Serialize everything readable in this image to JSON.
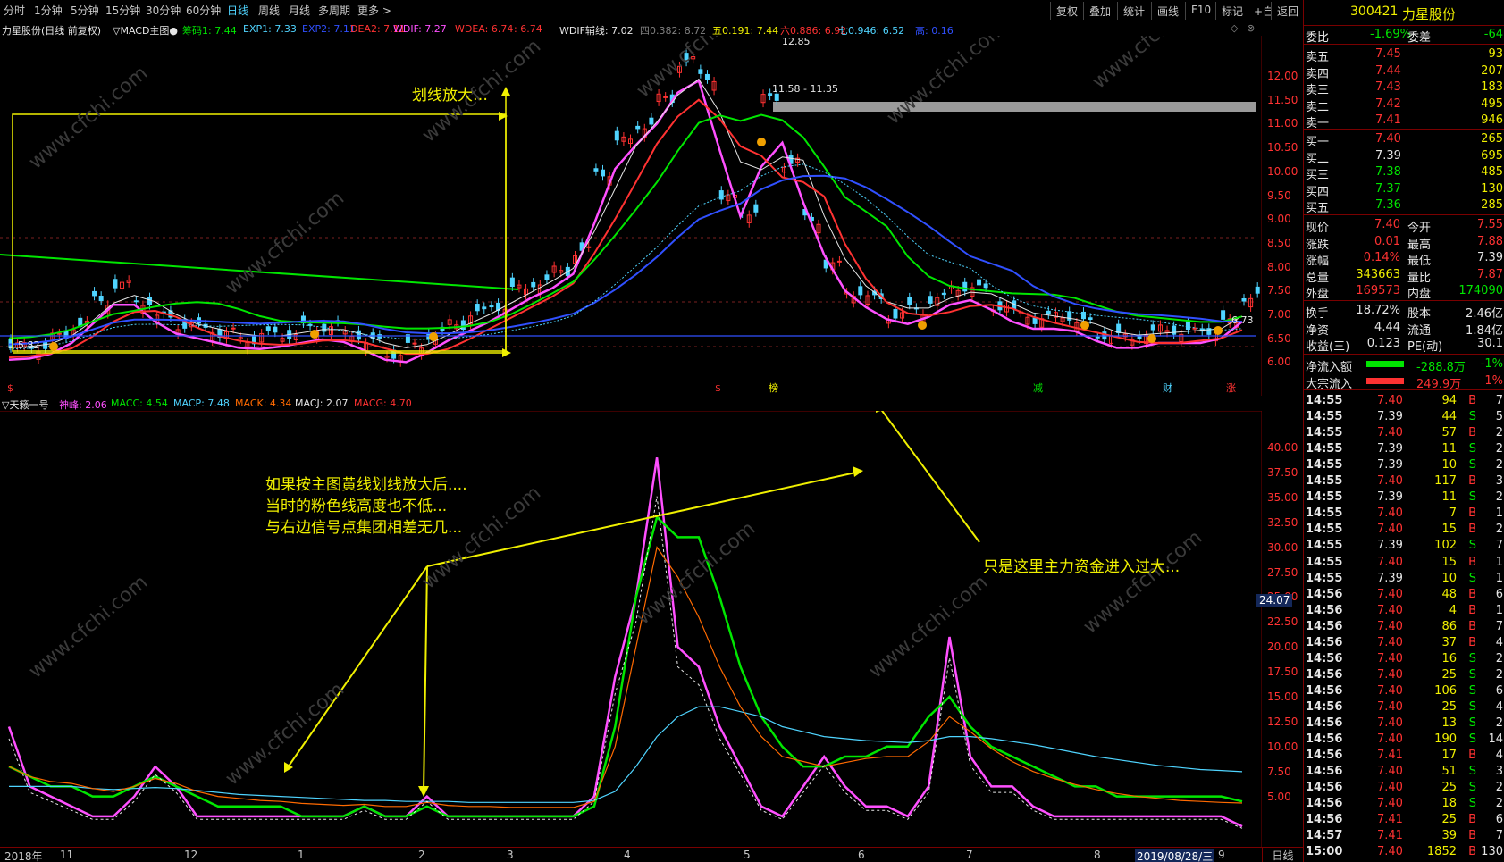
{
  "toolbar": {
    "periods": [
      "分时",
      "1分钟",
      "5分钟",
      "15分钟",
      "30分钟",
      "60分钟",
      "日线",
      "周线",
      "月线",
      "多周期",
      "更多"
    ],
    "active_period": "日线",
    "right_buttons": [
      "复权",
      "叠加",
      "统计",
      "画线",
      "F10",
      "标记",
      "+自选",
      "返回"
    ]
  },
  "main_header": {
    "stock": "力星股份(日线 前复权)",
    "indicator": "▽MACD主图●",
    "items": [
      {
        "label": "筹码1: 7.44",
        "color": "#00e600"
      },
      {
        "label": "EXP1: 7.33",
        "color": "#4fd4ff"
      },
      {
        "label": "EXP2: 7.11",
        "color": "#3050ff"
      },
      {
        "label": "DEA2: 7.11",
        "color": "#ff3232"
      },
      {
        "label": "WDIF: 7.27",
        "color": "#ff50ff"
      },
      {
        "label": "WDEA: 6.74",
        "color": "#ff3232"
      },
      {
        "label": ": 6.74",
        "color": "#ff3232"
      },
      {
        "label": "WDIF辅线: 7.02",
        "color": "#e6e6e6"
      },
      {
        "label": "四0.382: 8.72",
        "color": "#808080"
      },
      {
        "label": "五0.191: 7.44",
        "color": "#f0f000"
      },
      {
        "label": "六0.886: 6.92",
        "color": "#ff3232"
      },
      {
        "label": "七0.946: 6.52",
        "color": "#4fd4ff"
      },
      {
        "label": "高: 0.16",
        "color": "#3050ff"
      }
    ]
  },
  "sub_header": {
    "indicator": "▽天籁一号",
    "items": [
      {
        "label": "神峰: 2.06",
        "color": "#ff50ff"
      },
      {
        "label": "MACC: 4.54",
        "color": "#00e600"
      },
      {
        "label": "MACP: 7.48",
        "color": "#4fd4ff"
      },
      {
        "label": "MACK: 4.34",
        "color": "#ff6a00"
      },
      {
        "label": "MACJ: 2.07",
        "color": "#e6e6e6"
      },
      {
        "label": "MACG: 4.70",
        "color": "#ff3232"
      }
    ]
  },
  "main_axis": [
    "12.00",
    "11.50",
    "11.00",
    "10.50",
    "10.00",
    "9.50",
    "9.00",
    "8.50",
    "8.00",
    "7.50",
    "7.00",
    "6.50",
    "6.00"
  ],
  "sub_axis": [
    "40.00",
    "37.50",
    "35.00",
    "32.50",
    "30.00",
    "27.50",
    "25.00",
    "22.50",
    "20.00",
    "17.50",
    "15.00",
    "12.50",
    "10.00",
    "7.50",
    "5.00"
  ],
  "sub_axis_current": "24.07",
  "date_axis": {
    "labels": [
      "2018年",
      "11",
      "12",
      "1",
      "2",
      "3",
      "4",
      "5",
      "6",
      "7",
      "8",
      "2019/08/28/三",
      "9"
    ],
    "period_label": "日线"
  },
  "chart_labels": {
    "high_price": "12.85",
    "range_label": "11.58 - 11.35",
    "low_price": "5.82",
    "last_price": "6.73",
    "event_markers": [
      "$",
      "$",
      "榜",
      "减",
      "财",
      "涨"
    ]
  },
  "annotations": {
    "zoom": "划线放大…",
    "explain": [
      "如果按主图黄线划线放大后....",
      "当时的粉色线高度也不低...",
      "与右边信号点集团相差无几..."
    ],
    "main_force": "只是这里主力资金进入过大..."
  },
  "watermark": "www.cfchi.com",
  "quote": {
    "code": "300421",
    "name": "力星股份",
    "weibi_label": "委比",
    "weibi": "-1.69%",
    "weicha_label": "委差",
    "weicha": "-64",
    "asks": [
      {
        "label": "卖五",
        "price": "7.45",
        "vol": "93"
      },
      {
        "label": "卖四",
        "price": "7.44",
        "vol": "207"
      },
      {
        "label": "卖三",
        "price": "7.43",
        "vol": "183"
      },
      {
        "label": "卖二",
        "price": "7.42",
        "vol": "495"
      },
      {
        "label": "卖一",
        "price": "7.41",
        "vol": "946"
      }
    ],
    "bids": [
      {
        "label": "买一",
        "price": "7.40",
        "vol": "265"
      },
      {
        "label": "买二",
        "price": "7.39",
        "vol": "695"
      },
      {
        "label": "买三",
        "price": "7.38",
        "vol": "485"
      },
      {
        "label": "买四",
        "price": "7.37",
        "vol": "130"
      },
      {
        "label": "买五",
        "price": "7.36",
        "vol": "285"
      }
    ],
    "stats": [
      {
        "l1": "现价",
        "v1": "7.40",
        "c1": "#ff3232",
        "l2": "今开",
        "v2": "7.55",
        "c2": "#ff3232"
      },
      {
        "l1": "涨跌",
        "v1": "0.01",
        "c1": "#ff3232",
        "l2": "最高",
        "v2": "7.88",
        "c2": "#ff3232"
      },
      {
        "l1": "涨幅",
        "v1": "0.14%",
        "c1": "#ff3232",
        "l2": "最低",
        "v2": "7.39",
        "c2": "#e6e6e6"
      },
      {
        "l1": "总量",
        "v1": "343663",
        "c1": "#f0f000",
        "l2": "量比",
        "v2": "7.87",
        "c2": "#ff3232"
      },
      {
        "l1": "外盘",
        "v1": "169573",
        "c1": "#ff3232",
        "l2": "内盘",
        "v2": "174090",
        "c2": "#00e600"
      }
    ],
    "stats2": [
      {
        "l1": "换手",
        "v1": "18.72%",
        "l2": "股本",
        "v2": "2.46亿"
      },
      {
        "l1": "净资",
        "v1": "4.44",
        "l2": "流通",
        "v2": "1.84亿"
      },
      {
        "l1": "收益(三)",
        "v1": "0.123",
        "l2": "PE(动)",
        "v2": "30.1"
      }
    ],
    "flows": [
      {
        "label": "净流入额",
        "value": "-288.8万",
        "pct": "-1%",
        "bar": "#00e600"
      },
      {
        "label": "大宗流入",
        "value": "249.9万",
        "pct": "1%",
        "bar": "#ff3232"
      }
    ],
    "ticks": [
      {
        "t": "14:55",
        "p": "7.40",
        "v": "94",
        "s": "B",
        "n": "7"
      },
      {
        "t": "14:55",
        "p": "7.39",
        "v": "44",
        "s": "S",
        "n": "5"
      },
      {
        "t": "14:55",
        "p": "7.40",
        "v": "57",
        "s": "B",
        "n": "2"
      },
      {
        "t": "14:55",
        "p": "7.39",
        "v": "11",
        "s": "S",
        "n": "2"
      },
      {
        "t": "14:55",
        "p": "7.39",
        "v": "10",
        "s": "S",
        "n": "2"
      },
      {
        "t": "14:55",
        "p": "7.40",
        "v": "117",
        "s": "B",
        "n": "3"
      },
      {
        "t": "14:55",
        "p": "7.39",
        "v": "11",
        "s": "S",
        "n": "2"
      },
      {
        "t": "14:55",
        "p": "7.40",
        "v": "7",
        "s": "B",
        "n": "1"
      },
      {
        "t": "14:55",
        "p": "7.40",
        "v": "15",
        "s": "B",
        "n": "2"
      },
      {
        "t": "14:55",
        "p": "7.39",
        "v": "102",
        "s": "S",
        "n": "7"
      },
      {
        "t": "14:55",
        "p": "7.40",
        "v": "15",
        "s": "B",
        "n": "1"
      },
      {
        "t": "14:55",
        "p": "7.39",
        "v": "10",
        "s": "S",
        "n": "1"
      },
      {
        "t": "14:56",
        "p": "7.40",
        "v": "48",
        "s": "B",
        "n": "6"
      },
      {
        "t": "14:56",
        "p": "7.40",
        "v": "4",
        "s": "B",
        "n": "1"
      },
      {
        "t": "14:56",
        "p": "7.40",
        "v": "86",
        "s": "B",
        "n": "7"
      },
      {
        "t": "14:56",
        "p": "7.40",
        "v": "37",
        "s": "B",
        "n": "4"
      },
      {
        "t": "14:56",
        "p": "7.40",
        "v": "16",
        "s": "S",
        "n": "2"
      },
      {
        "t": "14:56",
        "p": "7.40",
        "v": "25",
        "s": "S",
        "n": "2"
      },
      {
        "t": "14:56",
        "p": "7.40",
        "v": "106",
        "s": "S",
        "n": "6"
      },
      {
        "t": "14:56",
        "p": "7.40",
        "v": "25",
        "s": "S",
        "n": "4"
      },
      {
        "t": "14:56",
        "p": "7.40",
        "v": "13",
        "s": "S",
        "n": "2"
      },
      {
        "t": "14:56",
        "p": "7.40",
        "v": "190",
        "s": "S",
        "n": "14"
      },
      {
        "t": "14:56",
        "p": "7.41",
        "v": "17",
        "s": "B",
        "n": "4"
      },
      {
        "t": "14:56",
        "p": "7.40",
        "v": "51",
        "s": "S",
        "n": "3"
      },
      {
        "t": "14:56",
        "p": "7.40",
        "v": "25",
        "s": "S",
        "n": "2"
      },
      {
        "t": "14:56",
        "p": "7.40",
        "v": "18",
        "s": "S",
        "n": "2"
      },
      {
        "t": "14:56",
        "p": "7.41",
        "v": "25",
        "s": "B",
        "n": "6"
      },
      {
        "t": "14:57",
        "p": "7.41",
        "v": "39",
        "s": "B",
        "n": "7"
      },
      {
        "t": "15:00",
        "p": "7.40",
        "v": "1852",
        "s": "B",
        "n": "130"
      }
    ]
  },
  "chart_data": {
    "type": "line",
    "price_axis_range": [
      5.8,
      12.9
    ],
    "indicator_axis_range": [
      2,
      43
    ],
    "close_path": [
      6.3,
      6.35,
      6.5,
      6.8,
      7.3,
      7.6,
      7.3,
      6.9,
      6.8,
      6.7,
      6.6,
      6.5,
      6.55,
      6.6,
      6.7,
      6.75,
      6.6,
      6.4,
      6.2,
      6.3,
      6.6,
      6.8,
      7.0,
      7.2,
      7.5,
      7.7,
      7.9,
      8.3,
      10.0,
      10.6,
      11.0,
      11.5,
      12.3,
      12.0,
      9.4,
      9.2,
      11.5,
      10.2,
      9.0,
      8.0,
      7.5,
      7.3,
      7.0,
      7.1,
      7.3,
      7.6,
      7.5,
      7.2,
      7.0,
      6.9,
      7.0,
      6.8,
      6.6,
      6.5,
      6.6,
      6.7,
      6.6,
      6.7,
      6.8,
      7.4
    ],
    "series": [
      {
        "name": "神峰",
        "values": [
          12,
          6,
          5,
          4,
          3,
          3,
          5,
          8,
          6,
          3,
          3,
          3,
          3,
          3,
          3,
          3,
          3,
          4,
          3,
          3,
          5,
          3,
          3,
          3,
          3,
          3,
          3,
          3,
          5,
          17,
          25,
          39,
          20,
          18,
          12,
          8,
          4,
          3,
          6,
          9,
          6,
          4,
          4,
          3,
          6,
          21,
          9,
          6,
          6,
          4,
          3,
          3,
          3,
          3,
          3,
          3,
          3,
          3,
          3,
          2
        ]
      },
      {
        "name": "MACC",
        "values": [
          8,
          7,
          6,
          6,
          5,
          5,
          6,
          7,
          6,
          5,
          4,
          4,
          4,
          4,
          3,
          3,
          3,
          4,
          3,
          3,
          4,
          3,
          3,
          3,
          3,
          3,
          3,
          3,
          4,
          12,
          25,
          33,
          31,
          31,
          25,
          18,
          13,
          10,
          8,
          8,
          9,
          9,
          10,
          10,
          13,
          15,
          12,
          10,
          9,
          8,
          7,
          6,
          6,
          5,
          5,
          5,
          5,
          5,
          5,
          4.5
        ]
      },
      {
        "name": "MACP",
        "values": [
          6,
          6,
          6,
          6,
          5.8,
          5.7,
          5.8,
          5.9,
          5.8,
          5.6,
          5.4,
          5.2,
          5.1,
          5.0,
          4.9,
          4.8,
          4.7,
          4.6,
          4.6,
          4.5,
          4.5,
          4.5,
          4.4,
          4.4,
          4.4,
          4.4,
          4.4,
          4.4,
          4.6,
          5.5,
          8,
          11,
          13,
          14,
          14,
          13.5,
          13,
          12,
          11.5,
          11,
          10.8,
          10.6,
          10.5,
          10.4,
          10.6,
          11,
          11,
          10.8,
          10.5,
          10.2,
          9.8,
          9.4,
          9,
          8.7,
          8.4,
          8.1,
          7.9,
          7.7,
          7.6,
          7.48
        ]
      },
      {
        "name": "MACK",
        "values": [
          8,
          7,
          6.5,
          6.3,
          5.8,
          5.5,
          6,
          6.8,
          6.3,
          5.5,
          5,
          4.8,
          4.6,
          4.5,
          4.3,
          4.2,
          4.1,
          4.2,
          4,
          4,
          4.4,
          4.1,
          4,
          4,
          3.9,
          3.9,
          3.9,
          3.9,
          4.5,
          10,
          20,
          30,
          27,
          23,
          18,
          14,
          11,
          9,
          8.5,
          8,
          8.4,
          8.8,
          9,
          9,
          10.5,
          13,
          11.5,
          9.8,
          8.5,
          7.5,
          6.8,
          6.2,
          5.7,
          5.3,
          5,
          4.8,
          4.6,
          4.5,
          4.4,
          4.34
        ]
      }
    ]
  }
}
